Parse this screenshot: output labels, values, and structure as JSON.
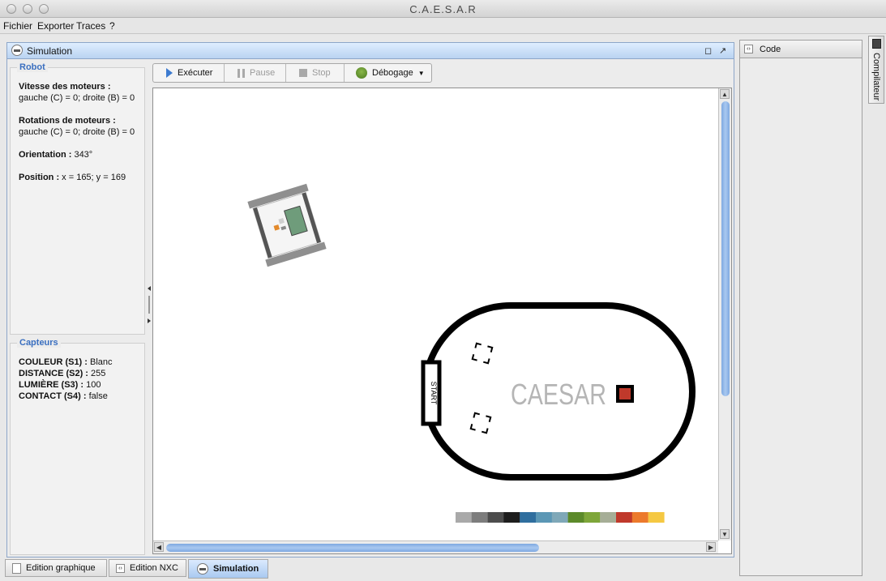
{
  "window": {
    "title": "C.A.E.S.A.R"
  },
  "menu": {
    "items": [
      "Fichier",
      "Exporter",
      "Traces",
      "?"
    ]
  },
  "simulation": {
    "title": "Simulation",
    "robot": {
      "title": "Robot",
      "motor_speed_label": "Vitesse des moteurs :",
      "motor_speed_value": "gauche (C) = 0; droite (B) = 0",
      "motor_rotation_label": "Rotations de moteurs :",
      "motor_rotation_value": "gauche (C) = 0; droite (B) = 0",
      "orientation_label": "Orientation :",
      "orientation_value": " 343°",
      "position_label": "Position :",
      "position_value": " x = 165; y = 169"
    },
    "sensors": {
      "title": "Capteurs",
      "items": [
        {
          "label": "COULEUR (S1) :",
          "value": " Blanc"
        },
        {
          "label": "DISTANCE (S2) :",
          "value": " 255"
        },
        {
          "label": "LUMIÈRE (S3) :",
          "value": " 100"
        },
        {
          "label": "CONTACT (S4) :",
          "value": " false"
        }
      ]
    },
    "toolbar": {
      "execute": "Exécuter",
      "pause": "Pause",
      "stop": "Stop",
      "debug": "Débogage"
    },
    "canvas": {
      "start_label": "START",
      "logo_text": "CAESAR",
      "palette": [
        "#a9a9a9",
        "#7d7d7d",
        "#4d4d4d",
        "#1e1e1e",
        "#2f6e9e",
        "#5b97b5",
        "#7fa8b8",
        "#5c8a2a",
        "#7ea63a",
        "#a6ae97",
        "#c0392b",
        "#ec7a2c",
        "#f5c842"
      ]
    }
  },
  "bottom_tabs": [
    {
      "label": "Edition graphique",
      "active": false
    },
    {
      "label": "Edition NXC",
      "active": false
    },
    {
      "label": "Simulation",
      "active": true
    }
  ],
  "code_panel": {
    "title": "Code"
  },
  "side_tab": {
    "label": "Compilateur"
  }
}
